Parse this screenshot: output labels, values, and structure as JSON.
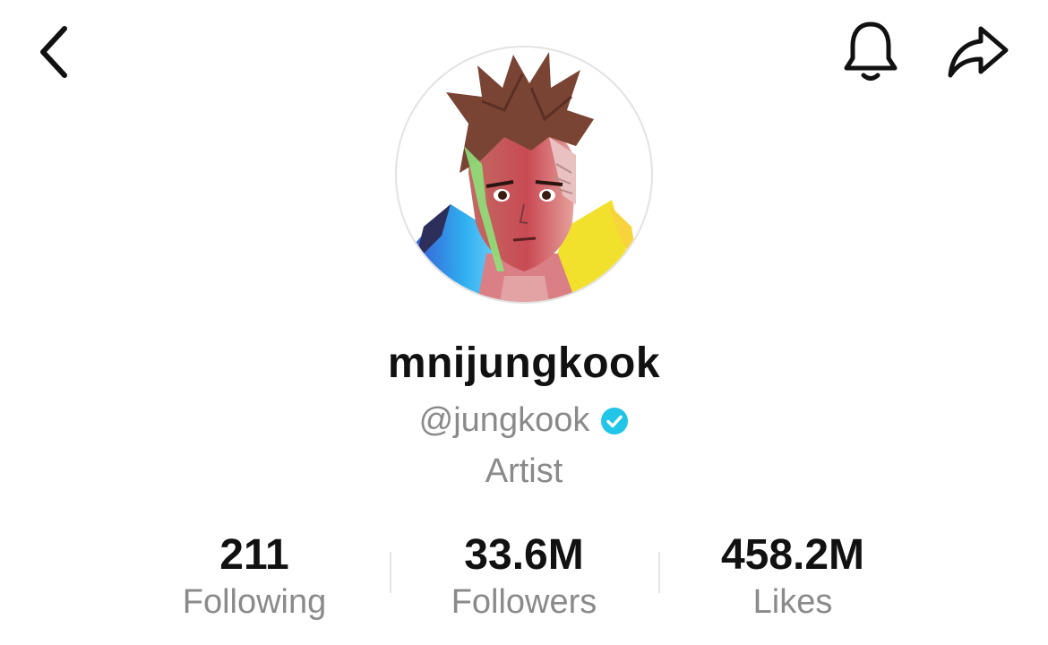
{
  "profile": {
    "display_name": "mnijungkook",
    "handle": "@jungkook",
    "verified": true,
    "bio": "Artist"
  },
  "stats": {
    "following": {
      "value": "211",
      "label": "Following"
    },
    "followers": {
      "value": "33.6M",
      "label": "Followers"
    },
    "likes": {
      "value": "458.2M",
      "label": "Likes"
    }
  },
  "icons": {
    "back": "chevron-left-icon",
    "notifications": "bell-icon",
    "share": "share-arrow-icon",
    "verified": "verified-check-icon"
  },
  "colors": {
    "verified_badge": "#20c5e8",
    "primary_text": "#111111",
    "secondary_text": "#8a8a8a"
  }
}
